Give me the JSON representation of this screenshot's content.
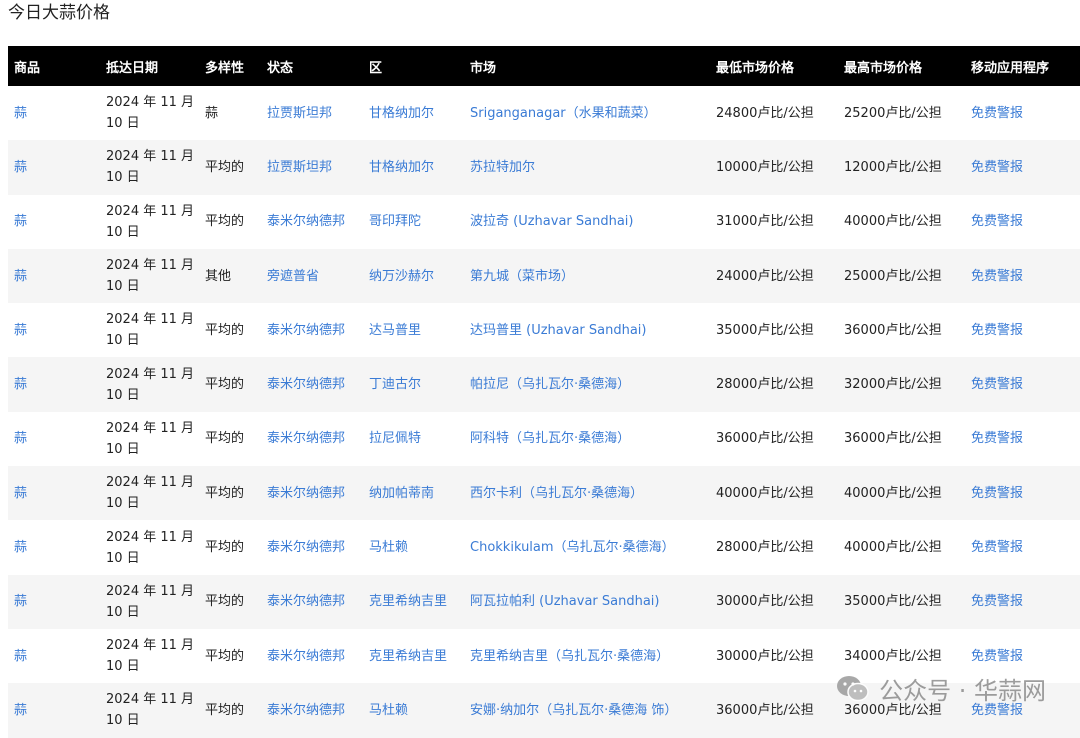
{
  "page": {
    "title": "今日大蒜价格"
  },
  "table": {
    "headers": [
      "商品",
      "抵达日期",
      "多样性",
      "状态",
      "区",
      "市场",
      "最低市场价格",
      "最高市场价格",
      "移动应用程序"
    ],
    "rows": [
      {
        "commodity": "蒜",
        "date": "2024 年 11 月 10 日",
        "variety": "蒜",
        "state": "拉贾斯坦邦",
        "district": "甘格纳加尔",
        "market": "Sriganganagar（水果和蔬菜）",
        "min": "24800卢比/公担",
        "max": "25200卢比/公担",
        "app": "免费警报"
      },
      {
        "commodity": "蒜",
        "date": "2024 年 11 月 10 日",
        "variety": "平均的",
        "state": "拉贾斯坦邦",
        "district": "甘格纳加尔",
        "market": "苏拉特加尔",
        "min": "10000卢比/公担",
        "max": "12000卢比/公担",
        "app": "免费警报"
      },
      {
        "commodity": "蒜",
        "date": "2024 年 11 月 10 日",
        "variety": "平均的",
        "state": "泰米尔纳德邦",
        "district": "哥印拜陀",
        "market": "波拉奇 (Uzhavar Sandhai)",
        "min": "31000卢比/公担",
        "max": "40000卢比/公担",
        "app": "免费警报"
      },
      {
        "commodity": "蒜",
        "date": "2024 年 11 月 10 日",
        "variety": "其他",
        "state": "旁遮普省",
        "district": "纳万沙赫尔",
        "market": "第九城（菜市场）",
        "min": "24000卢比/公担",
        "max": "25000卢比/公担",
        "app": "免费警报"
      },
      {
        "commodity": "蒜",
        "date": "2024 年 11 月 10 日",
        "variety": "平均的",
        "state": "泰米尔纳德邦",
        "district": "达马普里",
        "market": "达玛普里 (Uzhavar Sandhai)",
        "min": "35000卢比/公担",
        "max": "36000卢比/公担",
        "app": "免费警报"
      },
      {
        "commodity": "蒜",
        "date": "2024 年 11 月 10 日",
        "variety": "平均的",
        "state": "泰米尔纳德邦",
        "district": "丁迪古尔",
        "market": "帕拉尼（乌扎瓦尔·桑德海）",
        "min": "28000卢比/公担",
        "max": "32000卢比/公担",
        "app": "免费警报"
      },
      {
        "commodity": "蒜",
        "date": "2024 年 11 月 10 日",
        "variety": "平均的",
        "state": "泰米尔纳德邦",
        "district": "拉尼佩特",
        "market": "阿科特（乌扎瓦尔·桑德海）",
        "min": "36000卢比/公担",
        "max": "36000卢比/公担",
        "app": "免费警报"
      },
      {
        "commodity": "蒜",
        "date": "2024 年 11 月 10 日",
        "variety": "平均的",
        "state": "泰米尔纳德邦",
        "district": "纳加帕蒂南",
        "market": "西尔卡利（乌扎瓦尔·桑德海）",
        "min": "40000卢比/公担",
        "max": "40000卢比/公担",
        "app": "免费警报"
      },
      {
        "commodity": "蒜",
        "date": "2024 年 11 月 10 日",
        "variety": "平均的",
        "state": "泰米尔纳德邦",
        "district": "马杜赖",
        "market": "Chokkikulam（乌扎瓦尔·桑德海）",
        "min": "28000卢比/公担",
        "max": "40000卢比/公担",
        "app": "免费警报"
      },
      {
        "commodity": "蒜",
        "date": "2024 年 11 月 10 日",
        "variety": "平均的",
        "state": "泰米尔纳德邦",
        "district": "克里希纳吉里",
        "market": "阿瓦拉帕利 (Uzhavar Sandhai)",
        "min": "30000卢比/公担",
        "max": "35000卢比/公担",
        "app": "免费警报"
      },
      {
        "commodity": "蒜",
        "date": "2024 年 11 月 10 日",
        "variety": "平均的",
        "state": "泰米尔纳德邦",
        "district": "克里希纳吉里",
        "market": "克里希纳吉里（乌扎瓦尔·桑德海）",
        "min": "30000卢比/公担",
        "max": "34000卢比/公担",
        "app": "免费警报"
      },
      {
        "commodity": "蒜",
        "date": "2024 年 11 月 10 日",
        "variety": "平均的",
        "state": "泰米尔纳德邦",
        "district": "马杜赖",
        "market": "安娜·纳加尔（乌扎瓦尔·桑德海 饰）",
        "min": "36000卢比/公担",
        "max": "36000卢比/公担",
        "app": "免费警报"
      }
    ]
  },
  "watermark": {
    "text": "公众号 · 华蒜网",
    "icon": "wechat-icon"
  }
}
